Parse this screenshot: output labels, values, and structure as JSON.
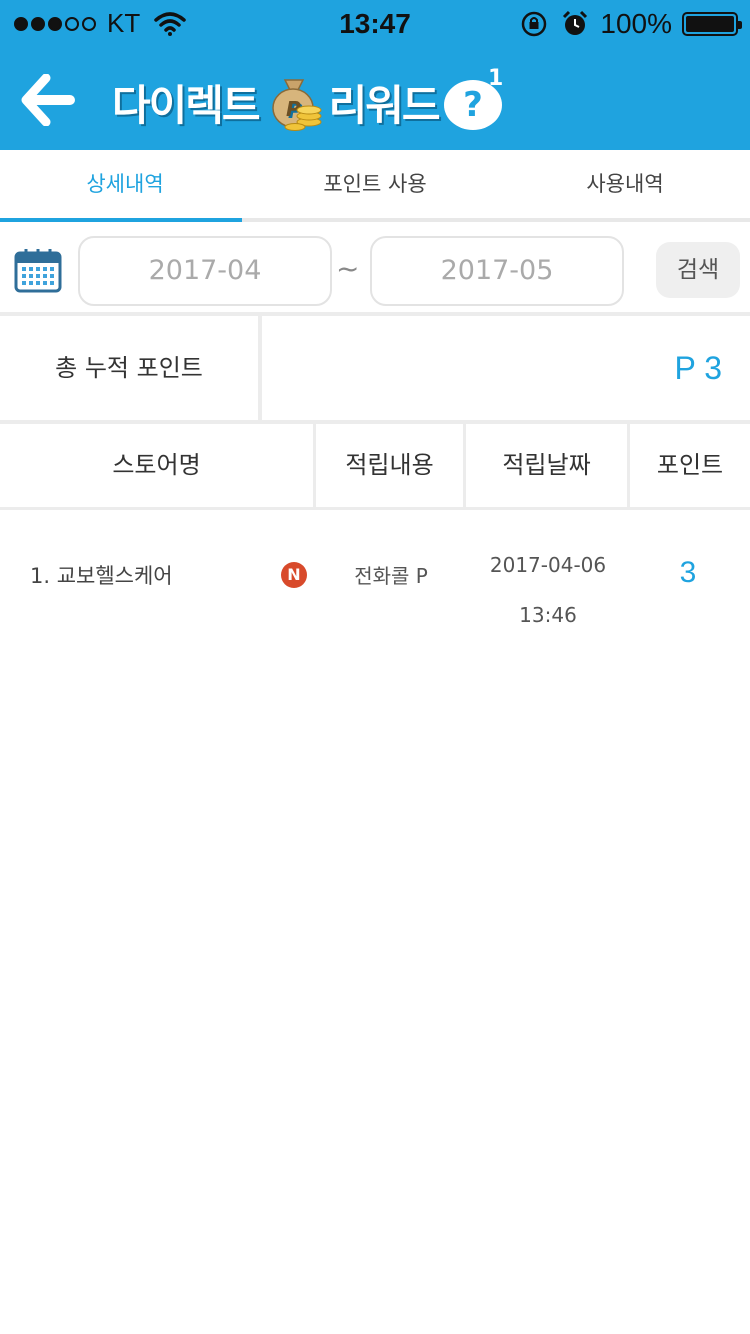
{
  "status_bar": {
    "carrier": "KT",
    "time": "13:47",
    "battery": "100%"
  },
  "nav": {
    "title_part1": "다이렉트",
    "title_part2": "리워드",
    "help_symbol": "?",
    "help_badge": "1"
  },
  "tabs": [
    {
      "label": "상세내역",
      "active": true
    },
    {
      "label": "포인트 사용",
      "active": false
    },
    {
      "label": "사용내역",
      "active": false
    }
  ],
  "filter": {
    "date_from": "2017-04",
    "separator": "~",
    "date_to": "2017-05",
    "search_label": "검색"
  },
  "total": {
    "label": "총 누적 포인트",
    "value": "P 3"
  },
  "table": {
    "headers": [
      "스토어명",
      "적립내용",
      "적립날짜",
      "포인트"
    ],
    "rows": [
      {
        "store": "1. 교보헬스케어",
        "badge": "N",
        "content": "전화콜 P",
        "date": "2017-04-06",
        "time": "13:46",
        "points": "3"
      }
    ]
  },
  "colors": {
    "brand": "#1fa3df",
    "badge": "#d84a2b"
  }
}
